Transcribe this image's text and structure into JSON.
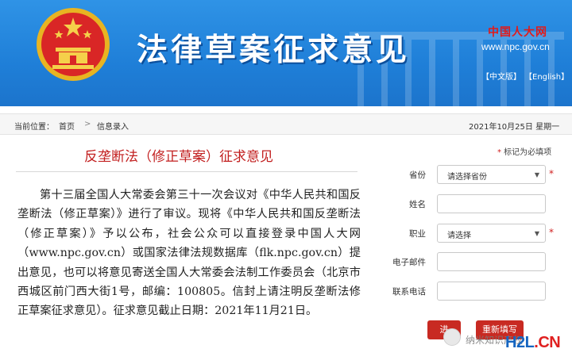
{
  "header": {
    "site_title": "法律草案征求意见",
    "npc_logo": "中国人大网",
    "npc_url": "www.npc.gov.cn",
    "lang_cn": "【中文版】",
    "lang_en": "【English】"
  },
  "breadcrumb": {
    "label": "当前位置：",
    "home": "首页",
    "separator": ">",
    "current": "信息录入",
    "date": "2021年10月25日  星期一"
  },
  "article": {
    "title": "反垄断法（修正草案）征求意见",
    "body": "第十三届全国人大常委会第三十一次会议对《中华人民共和国反垄断法（修正草案）》进行了审议。现将《中华人民共和国反垄断法（修正草案）》予以公布，社会公众可以直接登录中国人大网（www.npc.gov.cn）或国家法律法规数据库（flk.npc.gov.cn）提出意见，也可以将意见寄送全国人大常委会法制工作委员会（北京市西城区前门西大街1号，邮编：100805。信封上请注明反垄断法修正草案征求意见）。征求意见截止日期：2021年11月21日。"
  },
  "form": {
    "required_note_star": "*",
    "required_note": " 标记为必填项",
    "province_label": "省份",
    "province_value": "请选择省份",
    "name_label": "姓名",
    "job_label": "职业",
    "job_value": "请选择",
    "email_label": "电子邮件",
    "phone_label": "联系电话",
    "required_star": "*",
    "submit_label": "进",
    "reset_label": "重新填写"
  },
  "watermark": {
    "text": "纳米知识产权",
    "logo_a": "H2L",
    "logo_b": ".CN"
  },
  "colors": {
    "banner": "#1f7fd8",
    "accent_red": "#c21f1f",
    "button": "#c82a22"
  }
}
